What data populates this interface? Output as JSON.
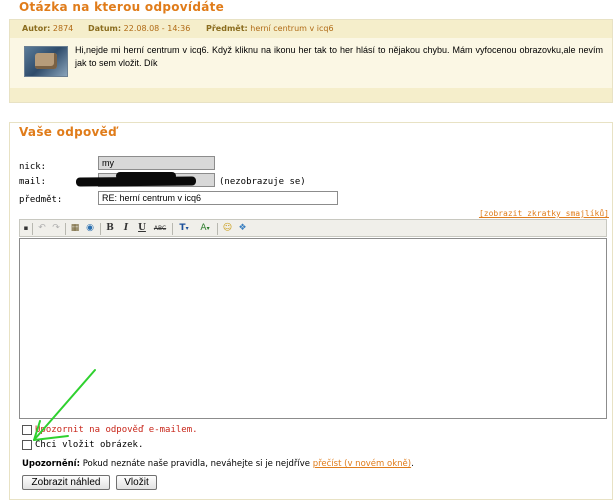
{
  "question": {
    "title": "Otázka na kterou odpovídáte",
    "meta": {
      "author_key": "Autor:",
      "author_val": "2874",
      "date_key": "Datum:",
      "date_val": "22.08.08 - 14:36",
      "subject_key": "Předmět:",
      "subject_val": "herní centrum v icq6"
    },
    "text": "Hi,nejde mi herní centrum v icq6. Když kliknu na ikonu her tak to her hlásí to nějakou chybu. Mám vyfocenou obrazovku,ale nevím jak to sem vložit. Dík"
  },
  "answer": {
    "title": "Vaše odpověď",
    "nick_label": "nick:",
    "nick_value": "my",
    "mail_label": "mail:",
    "mail_note": "(nezobrazuje se)",
    "subject_label": "předmět:",
    "subject_value": "RE: herní centrum v icq6",
    "smiley_link": "[zobrazit zkratky smajlíků]",
    "toolbar": {
      "undo": "↶",
      "redo": "↷",
      "paste": "▦",
      "spell": "◉",
      "bold": "B",
      "italic": "I",
      "underline": "U",
      "abc": "ABC",
      "font": "T",
      "color": "A",
      "smiley": "☺",
      "image": "❖"
    },
    "notify_label": "Upozornit na odpověď e-mailem.",
    "image_label": "Chci vložit obrázek.",
    "warning_strong": "Upozornění:",
    "warning_text": " Pokud neznáte naše pravidla, neváhejte si je nejdříve ",
    "warning_link": "přečíst (v novém okně)",
    "warning_end": ".",
    "preview_button": "Zobrazit náhled",
    "submit_button": "Vložit"
  },
  "colors": {
    "accent": "#e07c1a",
    "meta_bg": "#f5eecb",
    "arrow": "#2fd12f"
  }
}
